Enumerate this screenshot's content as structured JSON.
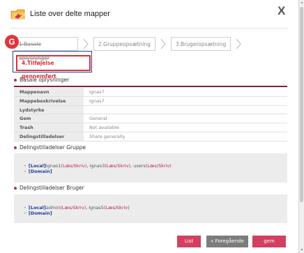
{
  "header": {
    "title": "Liste over delte mapper",
    "close": "X"
  },
  "badge": "G",
  "steps": [
    {
      "label": "1.Basale oplysninger"
    },
    {
      "label": "2.Gruppeopsætning"
    },
    {
      "label": "3.Brugeropsætning"
    },
    {
      "label": "4.Tilføjelse gennemført"
    }
  ],
  "basic": {
    "heading": "Basale oplysninger",
    "rows": [
      {
        "k": "Mappenavn",
        "v": "Ignas7"
      },
      {
        "k": "Mappebeskrivelse",
        "v": "Ignas7"
      },
      {
        "k": "Lydstyrke",
        "v": ""
      },
      {
        "k": "Gem",
        "v": "General"
      },
      {
        "k": "Trash",
        "v": "Not available"
      },
      {
        "k": "Delingstilladelser",
        "v": "Share generally"
      }
    ]
  },
  "group": {
    "heading": "Delingstilladelser Gruppe",
    "local_tag": "[Local]",
    "u1": "Ignas1",
    "p1": "(Læs/Skriv)",
    "sep1": ", ",
    "u2": "Ignas3",
    "p2": "(Læs/Skriv)",
    "sep2": ", ",
    "u3": "users",
    "p3": "(Læs/Skriv)",
    "domain_tag": "[Domain]"
  },
  "user": {
    "heading": "Delingstilladelser Bruger",
    "local_tag": "[Local]",
    "u1": "admin",
    "p1": "(Læs/Skriv)",
    "sep1": ", ",
    "u2": "Ignas5",
    "p2": "(Læs/Skriv)",
    "domain_tag": "[Domain]"
  },
  "buttons": {
    "list": "List",
    "prev": "« Foregående",
    "save": "gem"
  },
  "icons": {
    "folder": "shared-folder-icon",
    "arrow": "chevron-right-icon"
  },
  "colors": {
    "accent": "#d23f5f",
    "highlight": "#d9303a",
    "link": "#233a9a"
  }
}
